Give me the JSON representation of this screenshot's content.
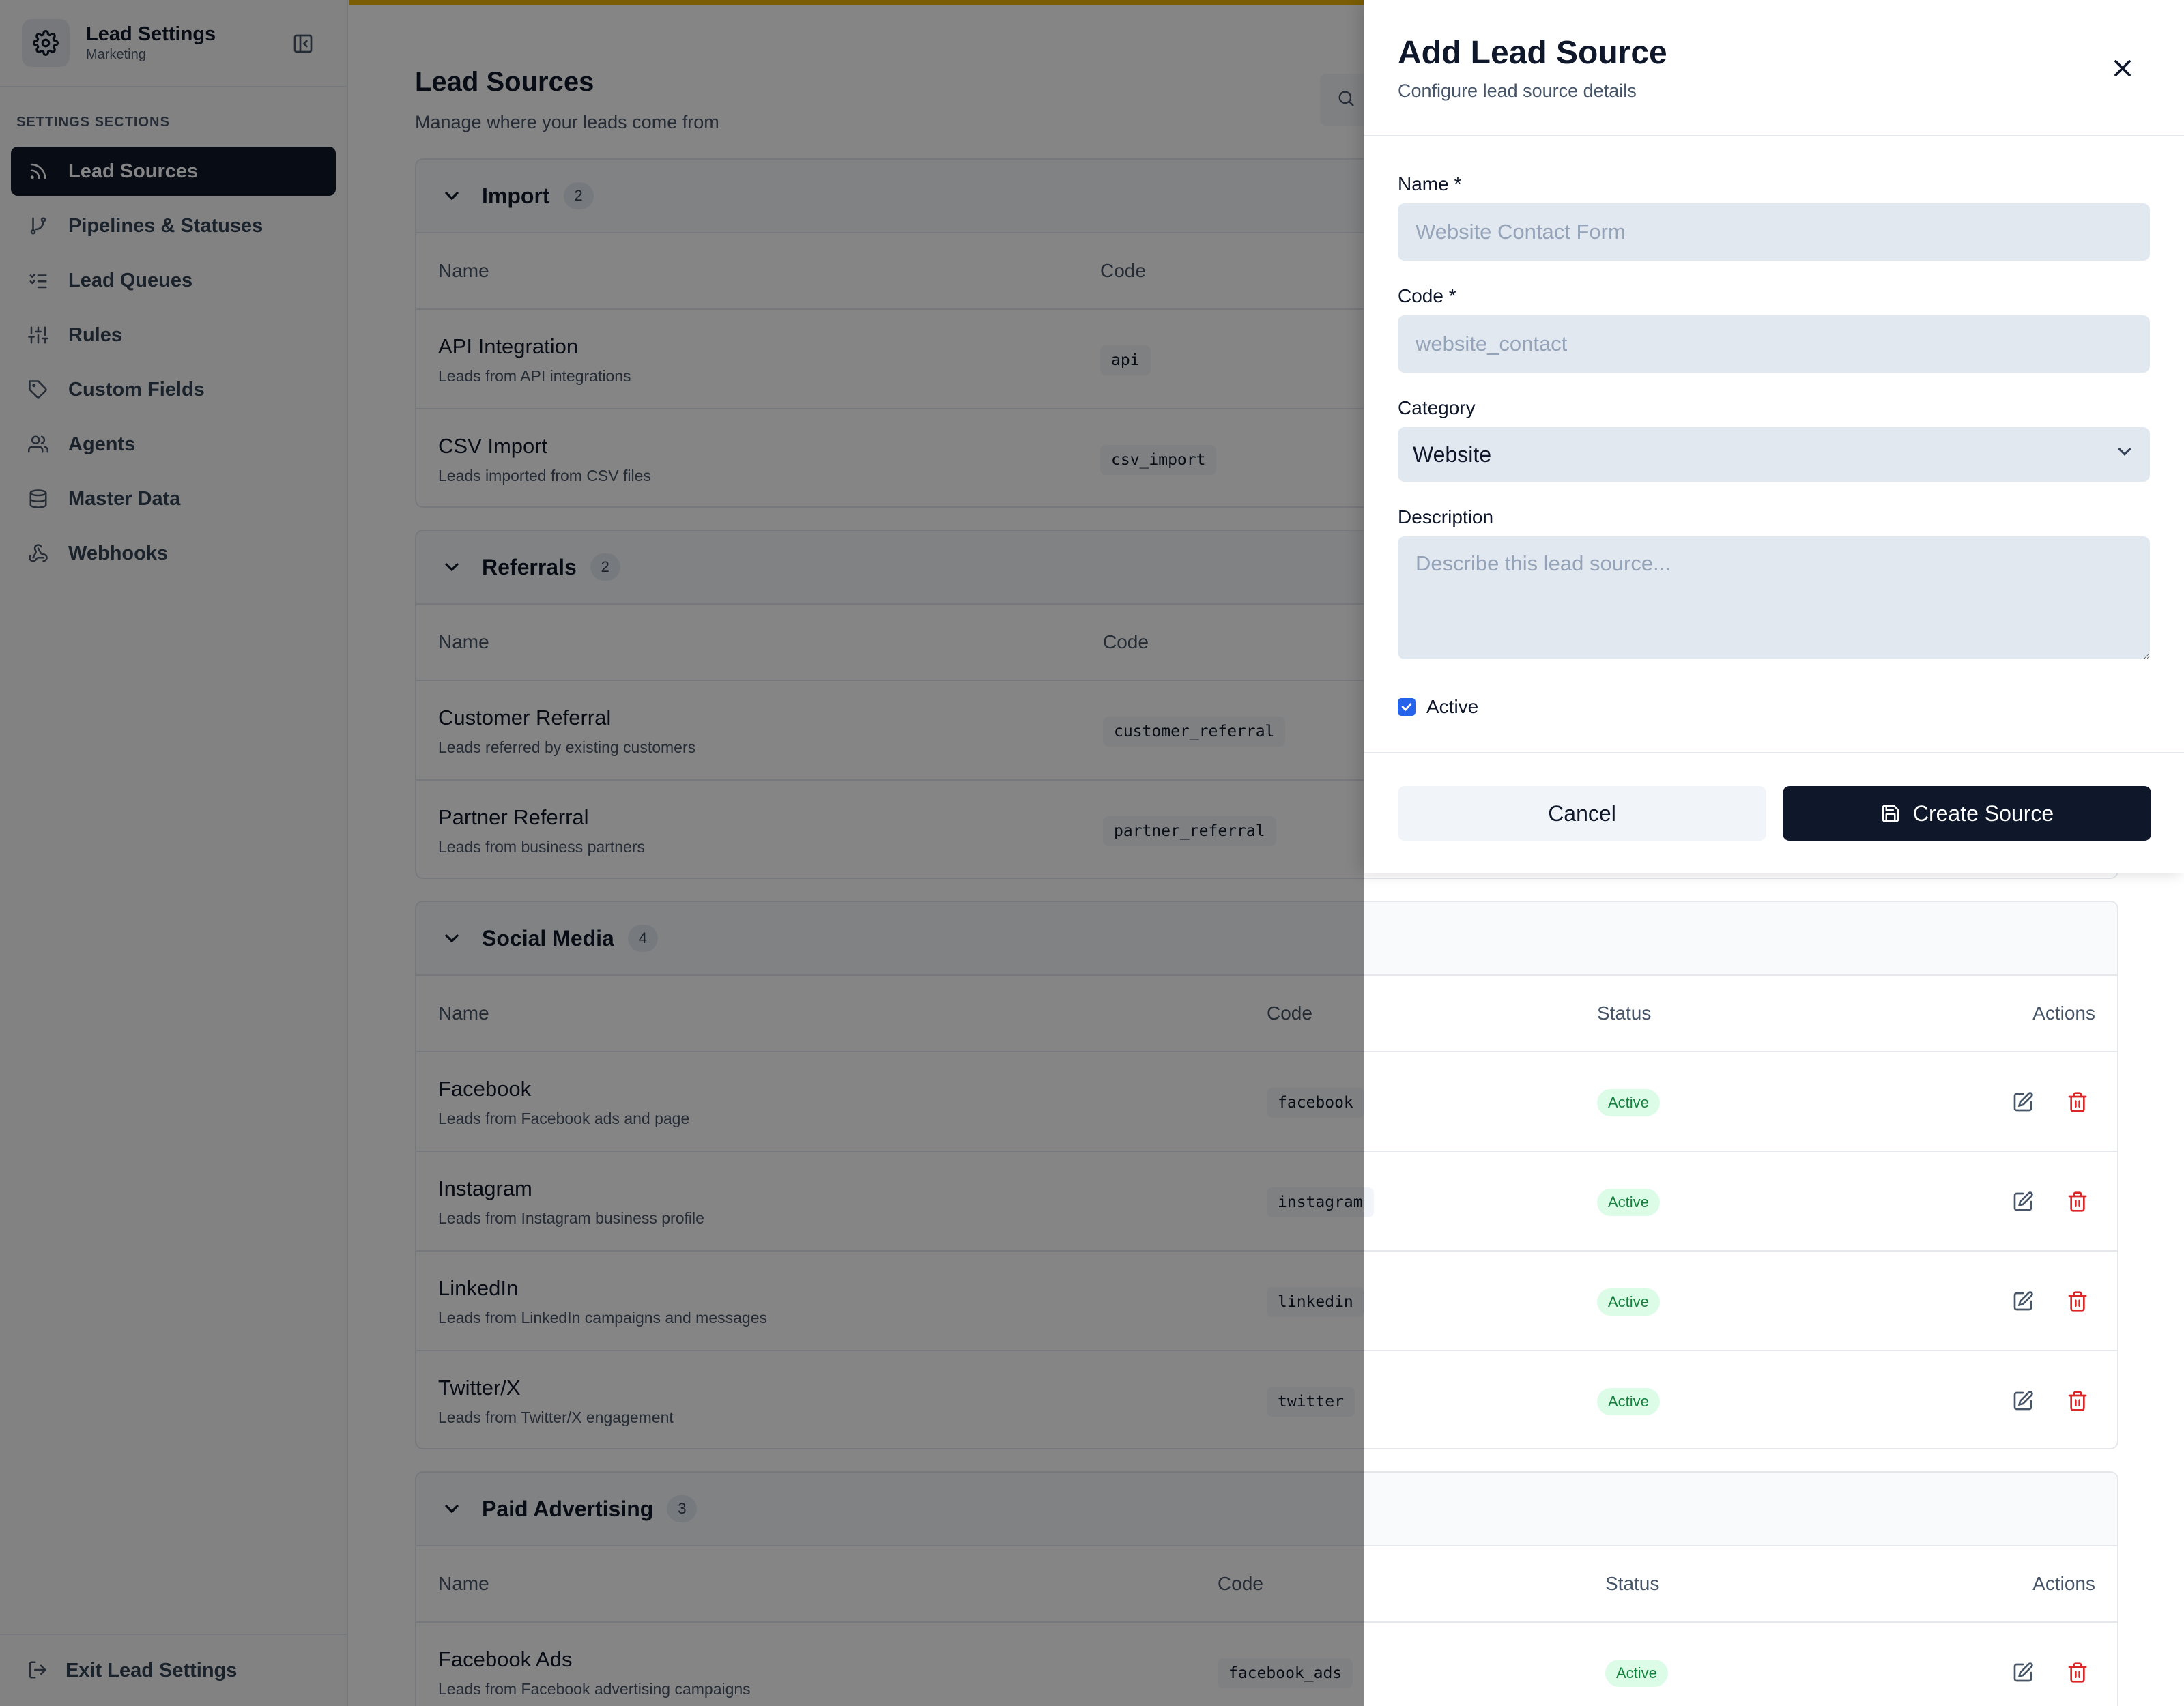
{
  "sidebar": {
    "title": "Lead Settings",
    "subtitle": "Marketing",
    "section_label": "SETTINGS SECTIONS",
    "items": [
      {
        "label": "Lead Sources",
        "icon": "rss-icon"
      },
      {
        "label": "Pipelines & Statuses",
        "icon": "git-branch-icon"
      },
      {
        "label": "Lead Queues",
        "icon": "list-checks-icon"
      },
      {
        "label": "Rules",
        "icon": "sliders-icon"
      },
      {
        "label": "Custom Fields",
        "icon": "tag-icon"
      },
      {
        "label": "Agents",
        "icon": "users-icon"
      },
      {
        "label": "Master Data",
        "icon": "database-icon"
      },
      {
        "label": "Webhooks",
        "icon": "webhook-icon"
      }
    ],
    "exit_label": "Exit Lead Settings"
  },
  "main": {
    "title": "Lead Sources",
    "subtitle": "Manage where your leads come from",
    "columns": {
      "name": "Name",
      "code": "Code",
      "status": "Status",
      "actions": "Actions"
    },
    "groups": [
      {
        "name": "Import",
        "count": "2",
        "rows": [
          {
            "name": "API Integration",
            "desc": "Leads from API integrations",
            "code": "api"
          },
          {
            "name": "CSV Import",
            "desc": "Leads imported from CSV files",
            "code": "csv_import"
          }
        ]
      },
      {
        "name": "Referrals",
        "count": "2",
        "rows": [
          {
            "name": "Customer Referral",
            "desc": "Leads referred by existing customers",
            "code": "customer_referral"
          },
          {
            "name": "Partner Referral",
            "desc": "Leads from business partners",
            "code": "partner_referral"
          }
        ]
      },
      {
        "name": "Social Media",
        "count": "4",
        "rows": [
          {
            "name": "Facebook",
            "desc": "Leads from Facebook ads and page",
            "code": "facebook",
            "status": "Active"
          },
          {
            "name": "Instagram",
            "desc": "Leads from Instagram business profile",
            "code": "instagram",
            "status": "Active"
          },
          {
            "name": "LinkedIn",
            "desc": "Leads from LinkedIn campaigns and messages",
            "code": "linkedin",
            "status": "Active"
          },
          {
            "name": "Twitter/X",
            "desc": "Leads from Twitter/X engagement",
            "code": "twitter",
            "status": "Active"
          }
        ]
      },
      {
        "name": "Paid Advertising",
        "count": "3",
        "rows": [
          {
            "name": "Facebook Ads",
            "desc": "Leads from Facebook advertising campaigns",
            "code": "facebook_ads",
            "status": "Active"
          }
        ]
      }
    ]
  },
  "drawer": {
    "title": "Add Lead Source",
    "subtitle": "Configure lead source details",
    "name_label": "Name *",
    "name_placeholder": "Website Contact Form",
    "code_label": "Code *",
    "code_placeholder": "website_contact",
    "category_label": "Category",
    "category_value": "Website",
    "description_label": "Description",
    "description_placeholder": "Describe this lead source...",
    "active_label": "Active",
    "active_checked": true,
    "cancel_label": "Cancel",
    "create_label": "Create Source"
  },
  "colors": {
    "accent_dark": "#0f172a",
    "status_active_bg": "#dcfce7",
    "status_active_fg": "#15803d",
    "delete_red": "#dc2626",
    "top_bar": "#eab308"
  }
}
